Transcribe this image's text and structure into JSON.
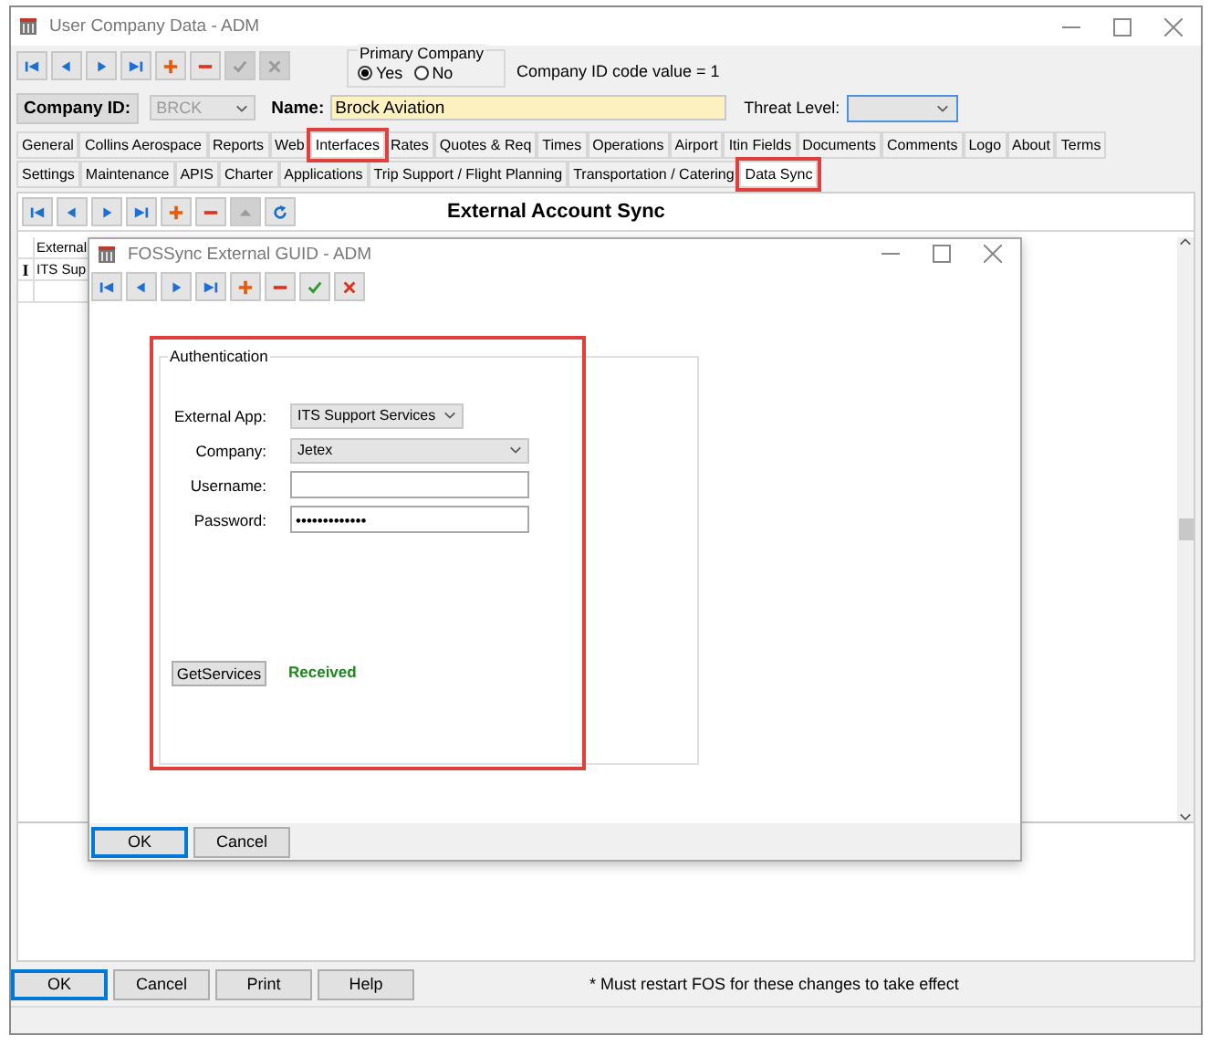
{
  "window": {
    "title": "User Company Data - ADM"
  },
  "toolbar": [
    {
      "kind": "first",
      "disabled": false
    },
    {
      "kind": "prev",
      "disabled": false
    },
    {
      "kind": "next",
      "disabled": false
    },
    {
      "kind": "last",
      "disabled": false
    },
    {
      "kind": "add",
      "disabled": false
    },
    {
      "kind": "delete",
      "disabled": false
    },
    {
      "kind": "save",
      "disabled": true
    },
    {
      "kind": "cancel",
      "disabled": true
    }
  ],
  "primary_company": {
    "label": "Primary Company",
    "options": [
      {
        "label": "Yes",
        "selected": true
      },
      {
        "label": "No",
        "selected": false
      }
    ]
  },
  "company_id_code": "Company ID code value = 1",
  "company_id": {
    "label": "Company ID:",
    "value": "BRCK",
    "disabled": true
  },
  "name": {
    "label": "Name:",
    "value": "Brock Aviation"
  },
  "threat_level": {
    "label": "Threat Level:"
  },
  "tabs": [
    {
      "label": "General",
      "selected": false,
      "highlighted": false
    },
    {
      "label": "Collins Aerospace",
      "selected": false,
      "highlighted": false
    },
    {
      "label": "Reports",
      "selected": false,
      "highlighted": false
    },
    {
      "label": "Web",
      "selected": false,
      "highlighted": false
    },
    {
      "label": "Interfaces",
      "selected": true,
      "highlighted": true
    },
    {
      "label": "Rates",
      "selected": false,
      "highlighted": false
    },
    {
      "label": "Quotes & Req",
      "selected": false,
      "highlighted": false
    },
    {
      "label": "Times",
      "selected": false,
      "highlighted": false
    },
    {
      "label": "Operations",
      "selected": false,
      "highlighted": false
    },
    {
      "label": "Airport",
      "selected": false,
      "highlighted": false
    },
    {
      "label": "Itin Fields",
      "selected": false,
      "highlighted": false
    },
    {
      "label": "Documents",
      "selected": false,
      "highlighted": false
    },
    {
      "label": "Comments",
      "selected": false,
      "highlighted": false
    },
    {
      "label": "Logo",
      "selected": false,
      "highlighted": false
    },
    {
      "label": "About",
      "selected": false,
      "highlighted": false
    },
    {
      "label": "Terms",
      "selected": false,
      "highlighted": false
    }
  ],
  "subtabs": [
    {
      "label": "Settings",
      "selected": false,
      "highlighted": false
    },
    {
      "label": "Maintenance",
      "selected": false,
      "highlighted": false
    },
    {
      "label": "APIS",
      "selected": false,
      "highlighted": false
    },
    {
      "label": "Charter",
      "selected": false,
      "highlighted": false
    },
    {
      "label": "Applications",
      "selected": false,
      "highlighted": false
    },
    {
      "label": "Trip Support / Flight Planning",
      "selected": false,
      "highlighted": false
    },
    {
      "label": "Transportation / Catering",
      "selected": false,
      "highlighted": false
    },
    {
      "label": "Data Sync",
      "selected": true,
      "highlighted": true
    }
  ],
  "sync_toolbar": [
    {
      "kind": "first",
      "disabled": false
    },
    {
      "kind": "prev",
      "disabled": false
    },
    {
      "kind": "next",
      "disabled": false
    },
    {
      "kind": "last",
      "disabled": false
    },
    {
      "kind": "add",
      "disabled": false
    },
    {
      "kind": "delete",
      "disabled": false
    },
    {
      "kind": "up",
      "disabled": true
    },
    {
      "kind": "refresh",
      "disabled": false
    }
  ],
  "section_title": "External Account Sync",
  "table": {
    "columns": [
      "External"
    ],
    "rows": [
      {
        "indicator": "I",
        "cells": [
          "ITS Sup"
        ]
      }
    ]
  },
  "dialog": {
    "title": "FOSSync External GUID - ADM",
    "toolbar": [
      {
        "kind": "first",
        "disabled": false
      },
      {
        "kind": "prev",
        "disabled": false
      },
      {
        "kind": "next",
        "disabled": false
      },
      {
        "kind": "last",
        "disabled": false
      },
      {
        "kind": "add",
        "disabled": false
      },
      {
        "kind": "delete",
        "disabled": false
      },
      {
        "kind": "save",
        "disabled": false
      },
      {
        "kind": "cancel",
        "disabled": false
      }
    ],
    "group": {
      "title": "Authentication",
      "highlighted": true,
      "fields": [
        {
          "kind": "combo",
          "label": "External App:",
          "value": "ITS Support Services"
        },
        {
          "kind": "select",
          "label": "Company:",
          "value": "Jetex"
        },
        {
          "kind": "text",
          "label": "Username:"
        },
        {
          "kind": "text",
          "label": "Password:",
          "value": "•••••••••••••"
        }
      ],
      "action": "GetServices",
      "status": "Received"
    },
    "buttons": [
      {
        "label": "OK",
        "default": true
      },
      {
        "label": "Cancel",
        "default": false
      }
    ]
  },
  "buttons": [
    {
      "label": "OK",
      "default": true
    },
    {
      "label": "Cancel",
      "default": false
    },
    {
      "label": "Print",
      "default": false
    },
    {
      "label": "Help",
      "default": false
    }
  ],
  "note": "* Must restart FOS for these changes to take effect"
}
